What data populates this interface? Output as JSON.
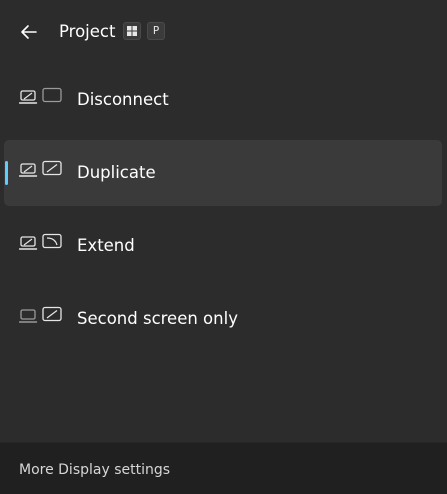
{
  "header": {
    "title": "Project",
    "shortcut_keys": {
      "windows_key_icon": "windows-logo-icon",
      "letter_key": "P"
    },
    "back_icon": "back-arrow-icon"
  },
  "options": [
    {
      "label": "Disconnect",
      "icon": "pc-screen-only-icon",
      "selected": false
    },
    {
      "label": "Duplicate",
      "icon": "duplicate-icon",
      "selected": true
    },
    {
      "label": "Extend",
      "icon": "extend-icon",
      "selected": false
    },
    {
      "label": "Second screen only",
      "icon": "second-screen-only-icon",
      "selected": false
    }
  ],
  "footer": {
    "link_label": "More Display settings"
  },
  "colors": {
    "background": "#2c2c2c",
    "selected_background": "#3a3a3a",
    "accent": "#60cdff",
    "footer_background": "#202020"
  }
}
